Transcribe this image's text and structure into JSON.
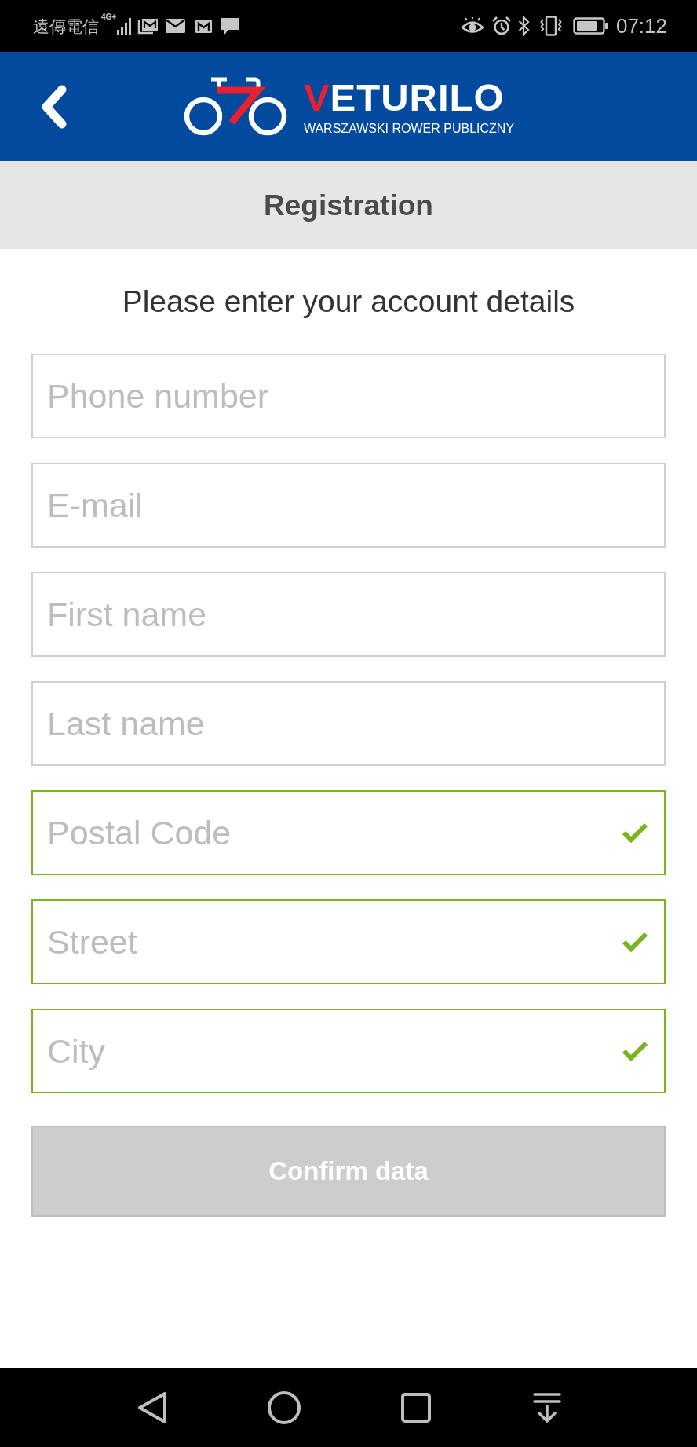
{
  "status_bar": {
    "carrier": "遠傳電信",
    "network": "4G+",
    "time": "07:12"
  },
  "header": {
    "logo_title": "VETURILO",
    "logo_subtitle": "WARSZAWSKI ROWER PUBLICZNY"
  },
  "page_title": "Registration",
  "instructions": "Please enter your account details",
  "fields": [
    {
      "placeholder": "Phone number",
      "valid": false
    },
    {
      "placeholder": "E-mail",
      "valid": false
    },
    {
      "placeholder": "First name",
      "valid": false
    },
    {
      "placeholder": "Last name",
      "valid": false
    },
    {
      "placeholder": "Postal Code",
      "valid": true
    },
    {
      "placeholder": "Street",
      "valid": true
    },
    {
      "placeholder": "City",
      "valid": true
    }
  ],
  "confirm_button": {
    "label": "Confirm data",
    "disabled": true
  }
}
